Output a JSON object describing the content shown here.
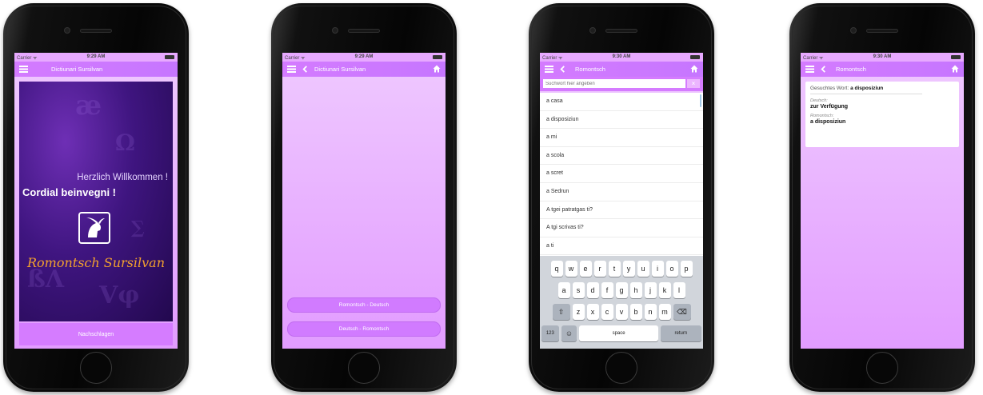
{
  "status_bar": {
    "carrier": "Carrier ᯤ",
    "time_1": "9:29 AM",
    "time_2": "9:29 AM",
    "time_3": "9:30 AM",
    "time_4": "9:30 AM"
  },
  "screen1": {
    "nav_title": "Dictiunari Sursilvan",
    "welcome_de": "Herzlich Willkommen !",
    "welcome_rm": "Cordial beinvegni !",
    "brand": "Romontsch Sursilvan",
    "lookup_button": "Nachschlagen"
  },
  "screen2": {
    "nav_title": "Dictiunari Sursilvan",
    "btn_rm_de": "Romontsch - Deutsch",
    "btn_de_rm": "Deutsch - Romontsch"
  },
  "screen3": {
    "nav_title": "Romontsch",
    "search_placeholder": "Suchwort hier angeben",
    "clear_label": "×",
    "results": [
      "a casa",
      "a disposiziun",
      "a mi",
      "a scola",
      "a scret",
      "a Sedrun",
      "A tgei patratgas ti?",
      "A tgi scrivas ti?",
      "a ti"
    ],
    "keyboard": {
      "row1": [
        "q",
        "w",
        "e",
        "r",
        "t",
        "y",
        "u",
        "i",
        "o",
        "p"
      ],
      "row2": [
        "a",
        "s",
        "d",
        "f",
        "g",
        "h",
        "j",
        "k",
        "l"
      ],
      "row3": [
        "z",
        "x",
        "c",
        "v",
        "b",
        "n",
        "m"
      ],
      "shift": "⇧",
      "delete": "⌫",
      "numbers": "123",
      "emoji": "☺",
      "space": "space",
      "return": "return"
    }
  },
  "screen4": {
    "nav_title": "Romontsch",
    "searched_label": "Gesuchtes Wort:",
    "searched_word": "a disposiziun",
    "de_label": "Deutsch:",
    "de_value": "zur Verfügung",
    "rm_label": "Romontsch:",
    "rm_value": "a disposiziun"
  },
  "icons": [
    "hamburger-menu-icon",
    "back-chevron-icon",
    "home-icon",
    "ibex-logo-icon"
  ],
  "colors": {
    "navbar": "#d47bff",
    "screen_bg": "#e8b4ff",
    "welcome_bg": "#3f1580",
    "brand_text": "#f3a12e",
    "pill": "#d17bff"
  }
}
